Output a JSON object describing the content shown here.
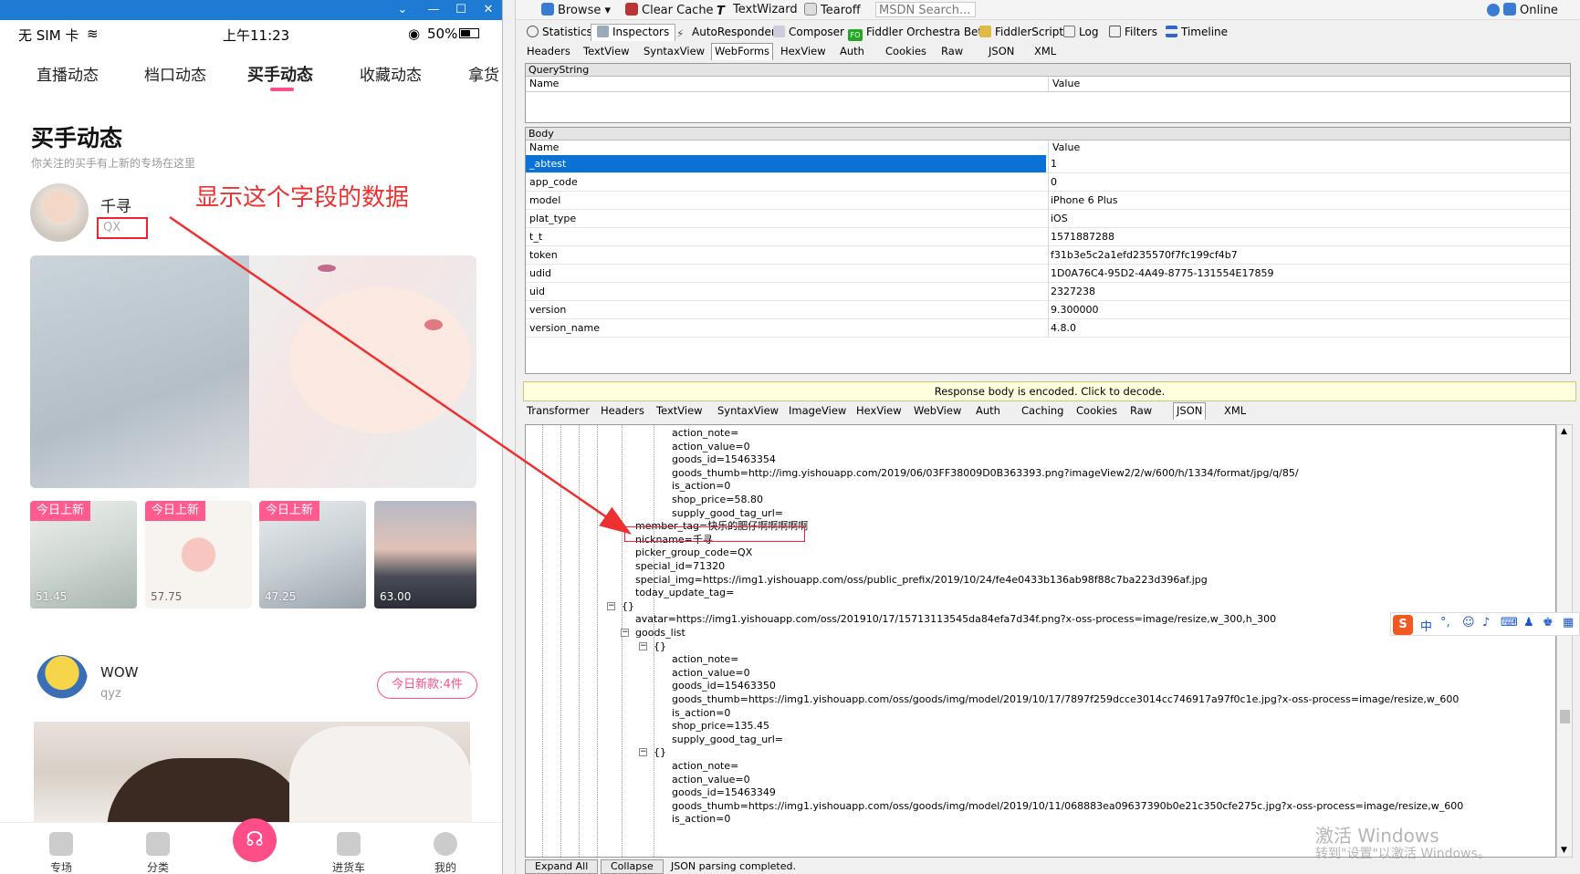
{
  "phone": {
    "status": {
      "carrier": "无 SIM 卡",
      "time": "上午11:23",
      "battery": "50%"
    },
    "tabs": [
      "直播动态",
      "档口动态",
      "买手动态",
      "收藏动态",
      "拿货"
    ],
    "section_title": "买手动态",
    "section_subtitle": "你关注的买手有上新的专场在这里",
    "user1": {
      "name": "千寻",
      "tag": "QX"
    },
    "annotation": "显示这个字段的数据",
    "thumbs": [
      {
        "badge": "今日上新",
        "price": "51.45"
      },
      {
        "badge": "今日上新",
        "price": "57.75"
      },
      {
        "badge": "今日上新",
        "price": "47.25"
      },
      {
        "badge": "",
        "price": "63.00"
      }
    ],
    "user2": {
      "name": "WOW",
      "sub": "qyz",
      "new_count": "今日新款:4件"
    },
    "bottom_nav": [
      "专场",
      "分类",
      "进货车",
      "我的"
    ]
  },
  "fiddler": {
    "toolbar": [
      "Browse",
      "Clear Cache",
      "TextWizard",
      "Tearoff",
      "MSDN Search...",
      "Online"
    ],
    "main_tabs": [
      "Statistics",
      "Inspectors",
      "AutoResponder",
      "Composer",
      "Fiddler Orchestra Beta",
      "FiddlerScript",
      "Log",
      "Filters",
      "Timeline"
    ],
    "request_tabs": [
      "Headers",
      "TextView",
      "SyntaxView",
      "WebForms",
      "HexView",
      "Auth",
      "Cookies",
      "Raw",
      "JSON",
      "XML"
    ],
    "querystring": {
      "title": "QueryString",
      "col_name": "Name",
      "col_value": "Value"
    },
    "body": {
      "title": "Body",
      "col_name": "Name",
      "col_value": "Value",
      "rows": [
        {
          "name": "_abtest",
          "value": "1"
        },
        {
          "name": "app_code",
          "value": "0"
        },
        {
          "name": "model",
          "value": "iPhone 6 Plus"
        },
        {
          "name": "plat_type",
          "value": "iOS"
        },
        {
          "name": "t_t",
          "value": "1571887288"
        },
        {
          "name": "token",
          "value": "f31b3e5c2a1efd235570f7fc199cf4b7"
        },
        {
          "name": "udid",
          "value": "1D0A76C4-95D2-4A49-8775-131554E17859"
        },
        {
          "name": "uid",
          "value": "2327238"
        },
        {
          "name": "version",
          "value": "9.300000"
        },
        {
          "name": "version_name",
          "value": "4.8.0"
        }
      ]
    },
    "encoded_banner": "Response body is encoded. Click to decode.",
    "response_tabs": [
      "Transformer",
      "Headers",
      "TextView",
      "SyntaxView",
      "ImageView",
      "HexView",
      "WebView",
      "Auth",
      "Caching",
      "Cookies",
      "Raw",
      "JSON",
      "XML"
    ],
    "json_lines": [
      "action_note=",
      "action_value=0",
      "goods_id=15463354",
      "goods_thumb=http://img.yishouapp.com/2019/06/03FF38009D0B363393.png?imageView2/2/w/600/h/1334/format/jpg/q/85/",
      "is_action=0",
      "shop_price=58.80",
      "supply_good_tag_url=",
      "member_tag=快乐的肥仔啊啊啊啊啊",
      "nickname=千寻",
      "picker_group_code=QX",
      "special_id=71320",
      "special_img=https://img1.yishouapp.com/oss/public_prefix/2019/10/24/fe4e0433b136ab98f88c7ba223d396af.jpg",
      "today_update_tag=",
      "{}",
      "avatar=https://img1.yishouapp.com/oss/201910/17/15713113545da84efa7d34f.png?x-oss-process=image/resize,w_300,h_300",
      "goods_list",
      "{}",
      "action_note=",
      "action_value=0",
      "goods_id=15463350",
      "goods_thumb=https://img1.yishouapp.com/oss/goods/img/model/2019/10/17/7897f259dcce3014cc746917a97f0c1e.jpg?x-oss-process=image/resize,w_600",
      "is_action=0",
      "shop_price=135.45",
      "supply_good_tag_url=",
      "{}",
      "action_note=",
      "action_value=0",
      "goods_id=15463349",
      "goods_thumb=https://img1.yishouapp.com/oss/goods/img/model/2019/10/11/068883ea09637390b0e21c350cfe275c.jpg?x-oss-process=image/resize,w_600",
      "is_action=0"
    ],
    "bottom": {
      "expand_all": "Expand All",
      "collapse": "Collapse",
      "status": "JSON parsing completed."
    },
    "ime": "中",
    "watermark": {
      "line1": "激活 Windows",
      "line2": "转到\"设置\"以激活 Windows。"
    }
  },
  "colors": {
    "accent_pink": "#ff4d88",
    "annotation_red": "#ee3030",
    "selection_blue": "#0a72d6"
  }
}
